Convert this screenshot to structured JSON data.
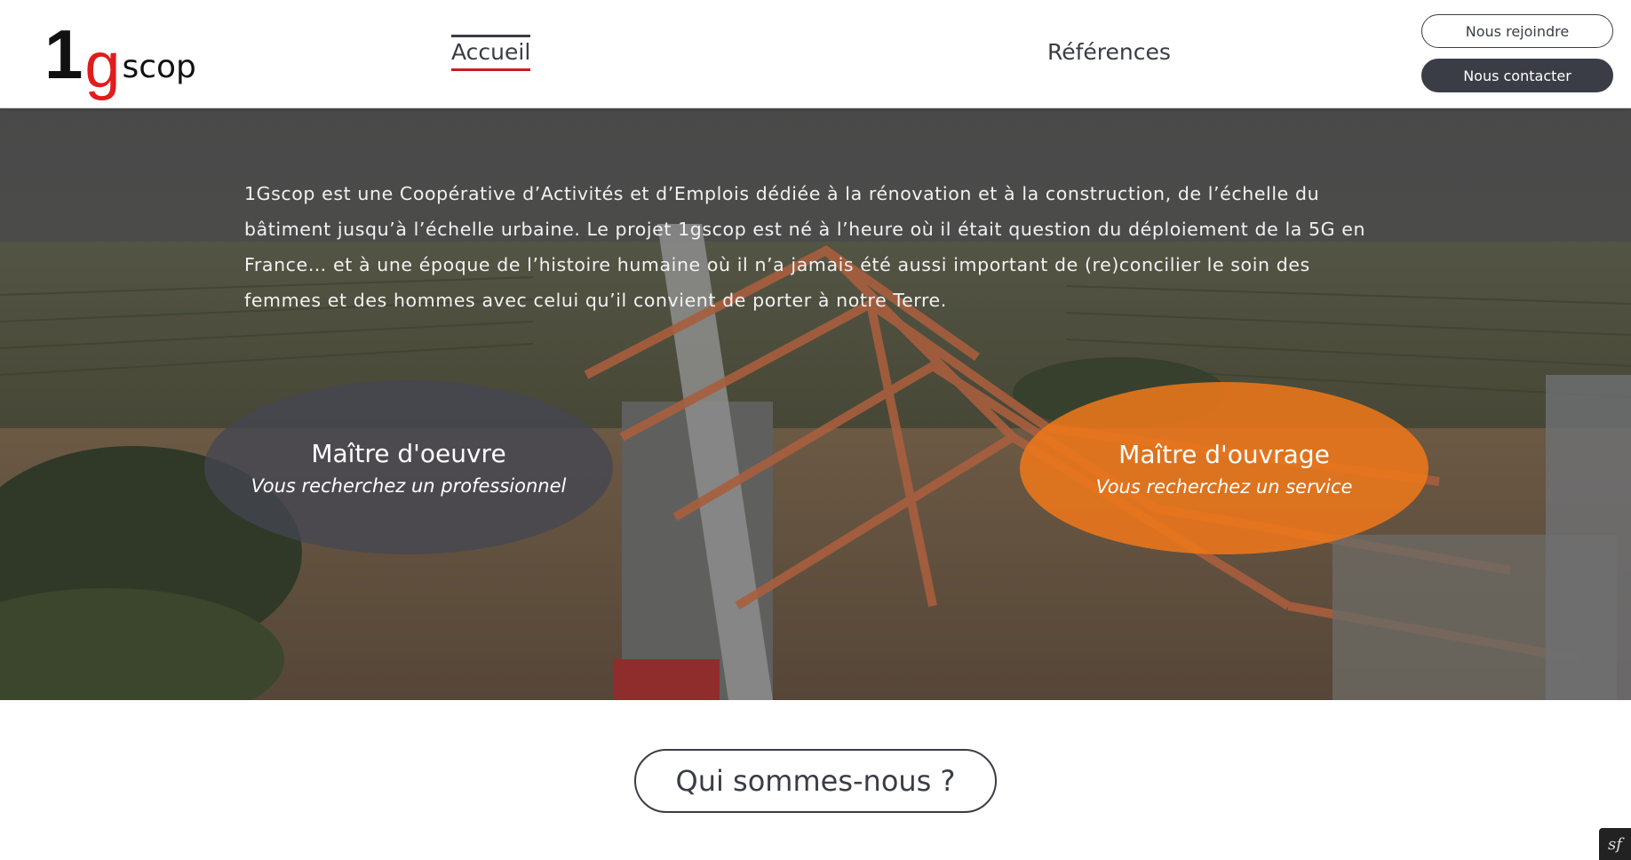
{
  "logo": {
    "one": "1",
    "g": "g",
    "scop": "scop"
  },
  "nav": {
    "home": "Accueil",
    "references": "Références"
  },
  "buttons": {
    "join": "Nous rejoindre",
    "contact": "Nous contacter"
  },
  "hero": {
    "text": "1Gscop est une Coopérative d’Activités et d’Emplois dédiée à la rénovation et à la construction, de l’échelle du bâtiment jusqu’à l’échelle urbaine. Le projet 1gscop est né à l’heure où il était question du déploiement de la 5G en France… et à une époque de l’histoire humaine où il n’a jamais été aussi important de (re)concilier le soin des femmes et des hommes avec celui qu’il convient de porter à notre Terre.",
    "moe": {
      "title": "Maître d'oeuvre",
      "subtitle": "Vous recherchez un professionnel"
    },
    "mou": {
      "title": "Maître d'ouvrage",
      "subtitle": "Vous recherchez un service"
    }
  },
  "about_button": "Qui sommes-nous ?",
  "colors": {
    "accent_red": "#c81e1e",
    "orange": "#f0781a",
    "dark": "#3a3d45"
  },
  "icons": {
    "debug_toolbar": "symfony-icon"
  }
}
